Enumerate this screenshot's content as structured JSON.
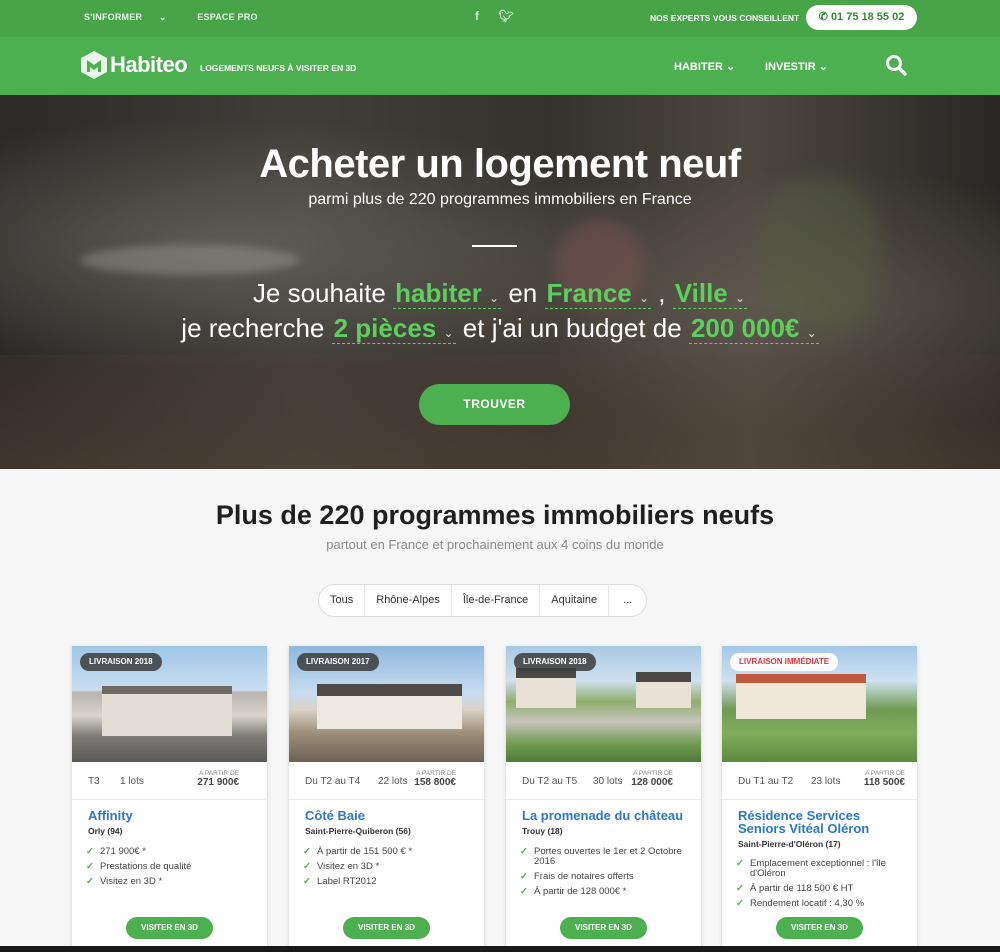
{
  "topbar": {
    "informer": "S'INFORMER",
    "espace_pro": "ESPACE PRO",
    "experts": "NOS EXPERTS VOUS CONSEILLENT",
    "phone": "01 75 18 55 02"
  },
  "nav": {
    "logo": "Habiteo",
    "tagline": "LOGEMENTS NEUFS À VISITER EN 3D",
    "items": [
      "HABITER",
      "INVESTIR"
    ]
  },
  "hero": {
    "title": "Acheter un logement neuf",
    "subtitle": "parmi plus de 220 programmes immobiliers en France",
    "line1_a": "Je souhaite",
    "sel_habiter": "habiter",
    "line1_b": "en",
    "sel_france": "France",
    "comma": ",",
    "sel_ville": "Ville",
    "line2_a": "je recherche",
    "sel_pieces": "2 pièces",
    "line2_b": "et j'ai un budget de",
    "sel_budget": "200 000€",
    "button": "TROUVER"
  },
  "programs": {
    "title": "Plus de 220 programmes immobiliers neufs",
    "subtitle": "partout en France et prochainement aux 4 coins du monde",
    "filters": [
      "Tous",
      "Rhône-Alpes",
      "Île-de-France",
      "Aquitaine",
      "..."
    ],
    "cards": [
      {
        "badge": "LIVRAISON 2018",
        "type": "T3",
        "lots": "1 lots",
        "price_label": "A PARTIR DE",
        "price": "271 900€",
        "name": "Affinity",
        "city": "Orly (94)",
        "features": [
          "271 900€ *",
          "Prestations de qualité",
          "Visitez en 3D *"
        ],
        "button": "VISITER EN 3D"
      },
      {
        "badge": "LIVRAISON 2017",
        "type": "Du T2 au T4",
        "lots": "22 lots",
        "price_label": "A PARTIR DE",
        "price": "158 800€",
        "name": "Côté Baie",
        "city": "Saint-Pierre-Quiberon (56)",
        "features": [
          "À partir de 151 500 € *",
          "Visitez en 3D *",
          "Label RT2012"
        ],
        "button": "VISITER EN 3D"
      },
      {
        "badge": "LIVRAISON 2018",
        "type": "Du T2 au T5",
        "lots": "30 lots",
        "price_label": "A PARTIR DE",
        "price": "128 000€",
        "name": "La promenade du château",
        "city": "Trouy (18)",
        "features": [
          "Portes ouvertes le 1er et 2 Octobre 2016",
          "Frais de notaires offerts",
          "À partir de 128 000€ *"
        ],
        "button": "VISITER EN 3D"
      },
      {
        "badge": "LIVRAISON IMMÉDIATE",
        "type": "Du T1 au T2",
        "lots": "23 lots",
        "price_label": "A PARTIR DE",
        "price": "118 500€",
        "name": "Résidence Services Seniors Vitéal Oléron",
        "city": "Saint-Pierre-d'Oléron (17)",
        "features": [
          "Emplacement exceptionnel : l'île d'Oléron",
          "À partir de 118 500 € HT",
          "Rendement locatif : 4,30 %"
        ],
        "button": "VISITER EN 3D"
      }
    ]
  }
}
